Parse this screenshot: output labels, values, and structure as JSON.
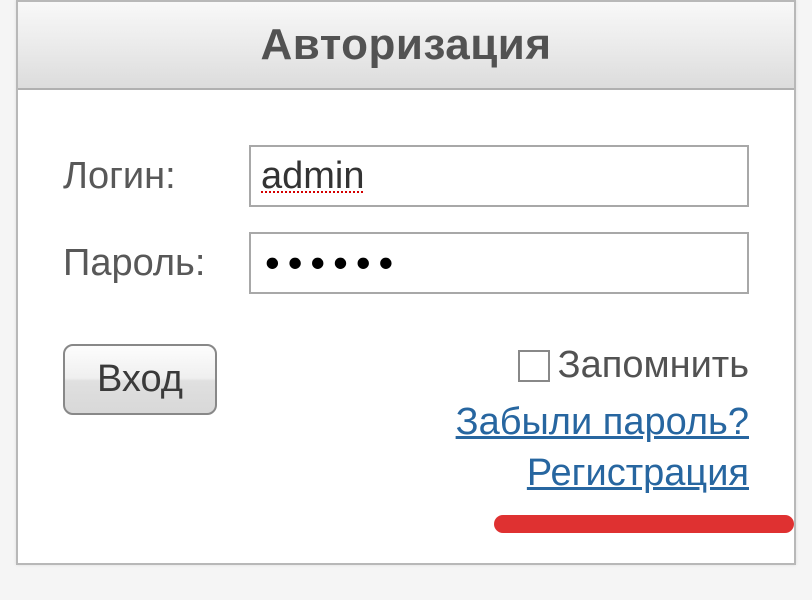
{
  "header": {
    "title": "Авторизация"
  },
  "form": {
    "login_label": "Логин:",
    "login_value": "admin",
    "password_label": "Пароль:",
    "password_value": "••••••",
    "submit_label": "Вход"
  },
  "options": {
    "remember_label": "Запомнить",
    "forgot_password_label": "Забыли пароль?",
    "register_label": "Регистрация"
  },
  "colors": {
    "link": "#2766a0",
    "highlight": "#dc2020"
  }
}
